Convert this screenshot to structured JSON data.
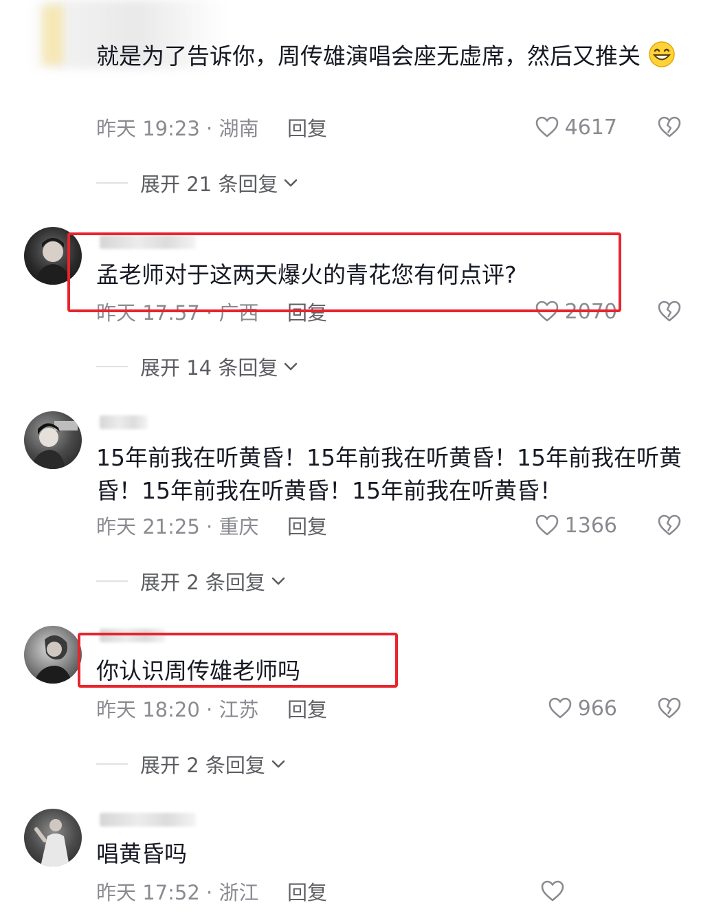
{
  "comments": [
    {
      "text": "就是为了告诉你，周传雄演唱会座无虚席，然后又推关",
      "emoji": "grinning-face-icon",
      "time": "昨天 19:23 · 湖南",
      "reply_label": "回复",
      "likes": "4617",
      "expand_label": "展开 21 条回复"
    },
    {
      "text": "孟老师对于这两天爆火的青花您有何点评?",
      "time": "昨天 17:57 · 广西",
      "reply_label": "回复",
      "likes": "2070",
      "expand_label": "展开 14 条回复"
    },
    {
      "text": "15年前我在听黄昏！15年前我在听黄昏！15年前我在听黄昏！15年前我在听黄昏！15年前我在听黄昏！",
      "time": "昨天 21:25 · 重庆",
      "reply_label": "回复",
      "likes": "1366",
      "expand_label": "展开 2 条回复"
    },
    {
      "text": "你认识周传雄老师吗",
      "time": "昨天 18:20 · 江苏",
      "reply_label": "回复",
      "likes": "966",
      "expand_label": "展开 2 条回复"
    },
    {
      "text": "唱黄昏吗",
      "time": "昨天 17:52 · 浙江",
      "reply_label": "回复",
      "likes": ""
    }
  ],
  "colors": {
    "text": "#161823",
    "meta": "#8a8b91",
    "highlight": "#e8242c",
    "background": "#ffffff"
  },
  "icons": {
    "like": "heart-outline-icon",
    "dislike": "broken-heart-icon",
    "expand": "chevron-down-icon"
  }
}
